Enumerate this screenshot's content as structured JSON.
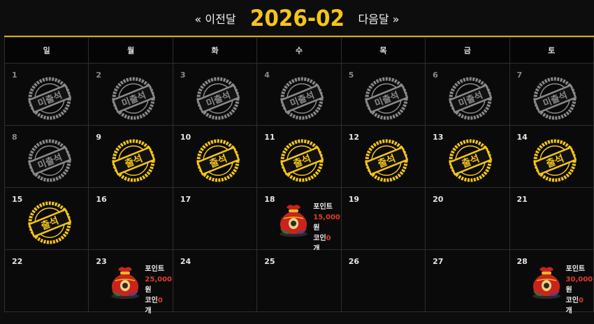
{
  "header": {
    "prev_label": "« 이전달",
    "current_month": "2026-02",
    "next_label": "다음달 »"
  },
  "weekdays": [
    "일",
    "월",
    "화",
    "수",
    "목",
    "금",
    "토"
  ],
  "stamps": {
    "absent_text": "미출석",
    "present_text": "출석"
  },
  "days": [
    {
      "day": "1",
      "status": "absent"
    },
    {
      "day": "2",
      "status": "absent"
    },
    {
      "day": "3",
      "status": "absent"
    },
    {
      "day": "4",
      "status": "absent"
    },
    {
      "day": "5",
      "status": "absent"
    },
    {
      "day": "6",
      "status": "absent"
    },
    {
      "day": "7",
      "status": "absent"
    },
    {
      "day": "8",
      "status": "absent"
    },
    {
      "day": "9",
      "status": "present"
    },
    {
      "day": "10",
      "status": "present"
    },
    {
      "day": "11",
      "status": "present"
    },
    {
      "day": "12",
      "status": "present"
    },
    {
      "day": "13",
      "status": "present"
    },
    {
      "day": "14",
      "status": "present"
    },
    {
      "day": "15",
      "status": "present"
    },
    {
      "day": "16",
      "status": "none"
    },
    {
      "day": "17",
      "status": "none"
    },
    {
      "day": "18",
      "status": "reward",
      "reward": {
        "point_label": "포인트",
        "point_value": "15,000",
        "point_unit": "원",
        "coin_label": "코인",
        "coin_value": "0",
        "coin_unit": "개"
      }
    },
    {
      "day": "19",
      "status": "none"
    },
    {
      "day": "20",
      "status": "none"
    },
    {
      "day": "21",
      "status": "none"
    },
    {
      "day": "22",
      "status": "none"
    },
    {
      "day": "23",
      "status": "reward",
      "reward": {
        "point_label": "포인트",
        "point_value": "25,000",
        "point_unit": "원",
        "coin_label": "코인",
        "coin_value": "0",
        "coin_unit": "개"
      }
    },
    {
      "day": "24",
      "status": "none"
    },
    {
      "day": "25",
      "status": "none"
    },
    {
      "day": "26",
      "status": "none"
    },
    {
      "day": "27",
      "status": "none"
    },
    {
      "day": "28",
      "status": "reward",
      "reward": {
        "point_label": "포인트",
        "point_value": "30,000",
        "point_unit": "원",
        "coin_label": "코인",
        "coin_value": "0",
        "coin_unit": "개"
      }
    }
  ],
  "colors": {
    "gold": "#f5c518",
    "sunday": "#e23b2e",
    "saturday": "#3b8ef0",
    "absent_stamp": "#8a8a8a",
    "reward_value": "#e23b2e"
  }
}
